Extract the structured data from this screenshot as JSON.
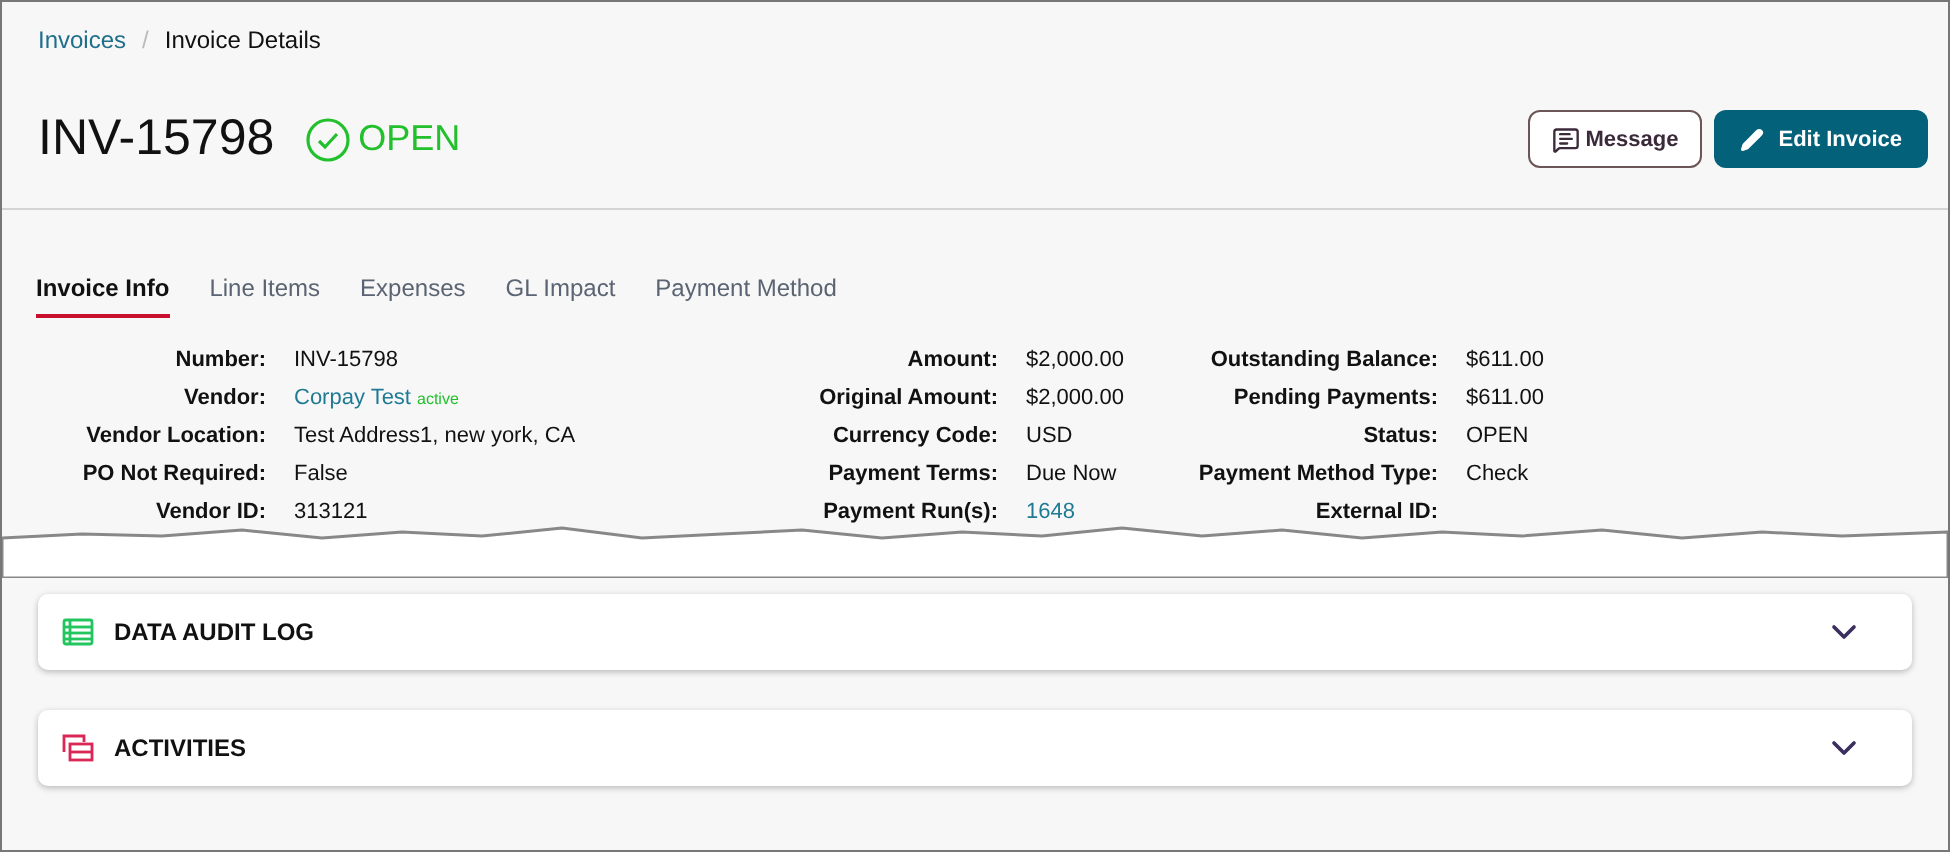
{
  "breadcrumb": [
    {
      "label": "Invoices",
      "link": true
    },
    {
      "separator": "/",
      "label": "Invoice Details",
      "link": false
    }
  ],
  "header": {
    "title": "INV-15798",
    "status": "OPEN"
  },
  "actions": [
    {
      "kind": "outline",
      "label": "Message"
    },
    {
      "kind": "primary",
      "label": "Edit Invoice"
    }
  ],
  "tabs": [
    {
      "label": "Invoice Info",
      "selected": true
    },
    {
      "label": "Line Items",
      "selected": false
    },
    {
      "label": "Expenses",
      "selected": false
    },
    {
      "label": "GL Impact",
      "selected": false
    },
    {
      "label": "Payment Method",
      "selected": false
    }
  ],
  "details": [
    [
      {
        "label": "Number:",
        "value": "INV-15798"
      },
      {
        "label": "Vendor:",
        "value": "Corpay Test",
        "link": true,
        "badge": "active"
      },
      {
        "label": "Vendor Location:",
        "value": "Test Address1, new york, CA"
      },
      {
        "label": "PO Not Required:",
        "value": "False"
      },
      {
        "label": "Vendor ID:",
        "value": "313121"
      }
    ],
    [
      {
        "label": "Amount:",
        "value": "$2,000.00"
      },
      {
        "label": "Original Amount:",
        "value": "$2,000.00"
      },
      {
        "label": "Currency Code:",
        "value": "USD"
      },
      {
        "label": "Payment Terms:",
        "value": "Due Now"
      },
      {
        "label": "Payment Run(s):",
        "value": "1648",
        "link": true
      }
    ],
    [
      {
        "label": "Outstanding Balance:",
        "value": "$611.00"
      },
      {
        "label": "Pending Payments:",
        "value": "$611.00"
      },
      {
        "label": "Status:",
        "value": "OPEN"
      },
      {
        "label": "Payment Method Type:",
        "value": "Check"
      },
      {
        "label": "External ID:"
      }
    ]
  ],
  "panels": [
    {
      "kind": "audit",
      "title": "DATA AUDIT LOG",
      "expanded": false
    },
    {
      "kind": "activities",
      "title": "ACTIVITIES",
      "expanded": false
    }
  ]
}
